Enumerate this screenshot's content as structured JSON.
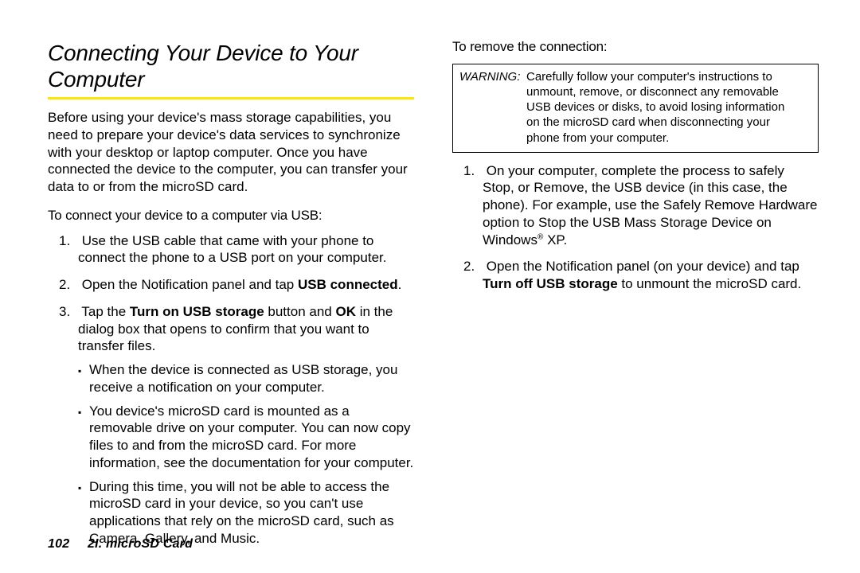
{
  "heading": "Connecting Your Device to Your Computer",
  "intro": "Before using your device's mass storage capabilities, you need to prepare your device's data services to synchronize with your desktop or laptop computer. Once you have connected the device to the computer, you can transfer your data to or from the microSD card.",
  "subhead_connect": "To connect your device to a computer via USB:",
  "connect": {
    "step1": "Use the USB cable that came with your phone to connect the phone to a USB port on your computer.",
    "step2_a": "Open the Notification panel and tap ",
    "step2_b": "USB connected",
    "step2_c": ".",
    "step3_a": "Tap the ",
    "step3_b": "Turn on USB storage",
    "step3_c": " button and ",
    "step3_d": "OK",
    "step3_e": " in the dialog box that opens to confirm that you want to transfer files.",
    "sub1": "When the device is connected as USB storage, you receive a notification on your computer.",
    "sub2": "You device's microSD card is mounted as a removable drive on your computer. You can now copy files to and from the microSD card. For more information, see the documentation for your computer.",
    "sub3": "During this time, you will not be able to access the microSD card in your device, so you can't use applications that rely on the microSD card, such as Camera, Gallery, and Music."
  },
  "subhead_remove": "To remove the connection:",
  "warning": {
    "label": "WARNING:",
    "body": "Carefully follow your computer's instructions to unmount, remove, or disconnect any removable USB devices or disks, to avoid losing information on the microSD card when disconnecting your phone from your computer."
  },
  "remove": {
    "step1_a": "On your computer, complete the process to safely Stop, or Remove, the USB device (in this case, the phone). For example, use the Safely Remove Hardware option to Stop the USB Mass Storage Device on Windows",
    "step1_b": "®",
    "step1_c": " XP.",
    "step2_a": "Open the Notification panel (on your device) and tap ",
    "step2_b": "Turn off USB storage",
    "step2_c": " to unmount the microSD card."
  },
  "footer": {
    "page_no": "102",
    "chapter": "2I. microSD Card"
  }
}
